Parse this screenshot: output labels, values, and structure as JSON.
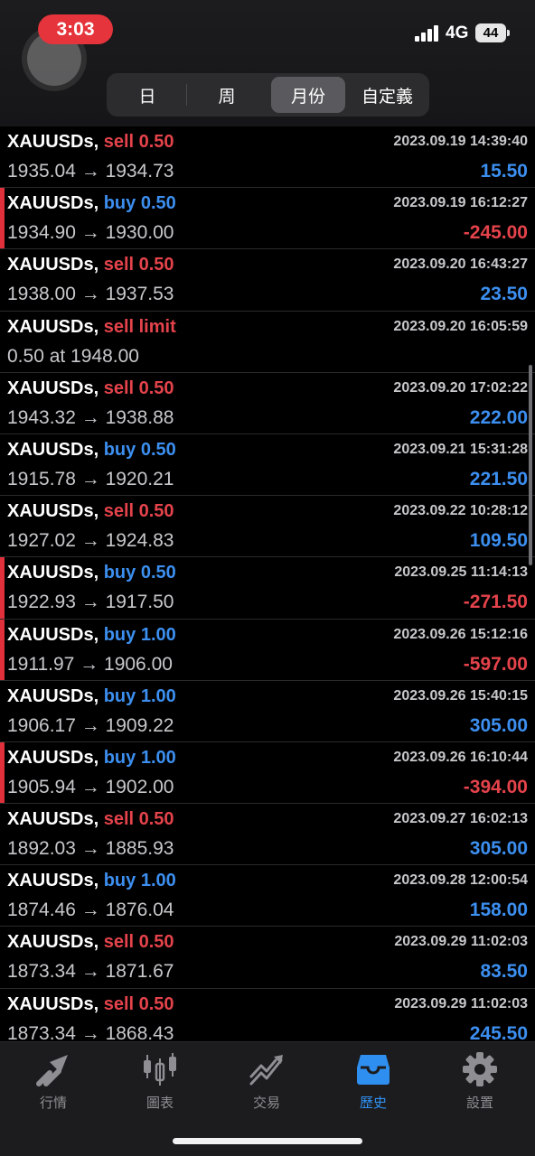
{
  "status_bar": {
    "time": "3:03",
    "network": "4G",
    "battery": "44"
  },
  "periods": [
    {
      "label": "日",
      "active": false
    },
    {
      "label": "周",
      "active": false
    },
    {
      "label": "月份",
      "active": true
    },
    {
      "label": "自定義",
      "active": false
    }
  ],
  "deals": [
    {
      "symbol": "XAUUSDs,",
      "side": "sell",
      "volume": "0.50",
      "datetime": "2023.09.19 14:39:40",
      "prices": "1935.04 → 1934.73",
      "profit": "15.50"
    },
    {
      "symbol": "XAUUSDs,",
      "side": "buy",
      "volume": "0.50",
      "datetime": "2023.09.19 16:12:27",
      "prices": "1934.90 → 1930.00",
      "profit": "-245.00"
    },
    {
      "symbol": "XAUUSDs,",
      "side": "sell",
      "volume": "0.50",
      "datetime": "2023.09.20 16:43:27",
      "prices": "1938.00 → 1937.53",
      "profit": "23.50"
    },
    {
      "symbol": "XAUUSDs,",
      "side": "sell",
      "volume": "limit",
      "datetime": "2023.09.20 16:05:59",
      "prices": "0.50 at 1948.00",
      "profit": ""
    },
    {
      "symbol": "XAUUSDs,",
      "side": "sell",
      "volume": "0.50",
      "datetime": "2023.09.20 17:02:22",
      "prices": "1943.32 → 1938.88",
      "profit": "222.00"
    },
    {
      "symbol": "XAUUSDs,",
      "side": "buy",
      "volume": "0.50",
      "datetime": "2023.09.21 15:31:28",
      "prices": "1915.78 → 1920.21",
      "profit": "221.50"
    },
    {
      "symbol": "XAUUSDs,",
      "side": "sell",
      "volume": "0.50",
      "datetime": "2023.09.22 10:28:12",
      "prices": "1927.02 → 1924.83",
      "profit": "109.50"
    },
    {
      "symbol": "XAUUSDs,",
      "side": "buy",
      "volume": "0.50",
      "datetime": "2023.09.25 11:14:13",
      "prices": "1922.93 → 1917.50",
      "profit": "-271.50"
    },
    {
      "symbol": "XAUUSDs,",
      "side": "buy",
      "volume": "1.00",
      "datetime": "2023.09.26 15:12:16",
      "prices": "1911.97 → 1906.00",
      "profit": "-597.00"
    },
    {
      "symbol": "XAUUSDs,",
      "side": "buy",
      "volume": "1.00",
      "datetime": "2023.09.26 15:40:15",
      "prices": "1906.17 → 1909.22",
      "profit": "305.00"
    },
    {
      "symbol": "XAUUSDs,",
      "side": "buy",
      "volume": "1.00",
      "datetime": "2023.09.26 16:10:44",
      "prices": "1905.94 → 1902.00",
      "profit": "-394.00"
    },
    {
      "symbol": "XAUUSDs,",
      "side": "sell",
      "volume": "0.50",
      "datetime": "2023.09.27 16:02:13",
      "prices": "1892.03 → 1885.93",
      "profit": "305.00"
    },
    {
      "symbol": "XAUUSDs,",
      "side": "buy",
      "volume": "1.00",
      "datetime": "2023.09.28 12:00:54",
      "prices": "1874.46 → 1876.04",
      "profit": "158.00"
    },
    {
      "symbol": "XAUUSDs,",
      "side": "sell",
      "volume": "0.50",
      "datetime": "2023.09.29 11:02:03",
      "prices": "1873.34 → 1871.67",
      "profit": "83.50"
    },
    {
      "symbol": "XAUUSDs,",
      "side": "sell",
      "volume": "0.50",
      "datetime": "2023.09.29 11:02:03",
      "prices": "1873.34 → 1868.43",
      "profit": "245.50"
    }
  ],
  "tabs": [
    {
      "label": "行情",
      "icon": "quotes-icon",
      "active": false
    },
    {
      "label": "圖表",
      "icon": "chart-icon",
      "active": false
    },
    {
      "label": "交易",
      "icon": "trade-icon",
      "active": false
    },
    {
      "label": "歷史",
      "icon": "history-icon",
      "active": true
    },
    {
      "label": "設置",
      "icon": "settings-icon",
      "active": false
    }
  ],
  "colors": {
    "sell": "#e5434b",
    "buy": "#3c8ff0",
    "loss_marker": "#e0303b",
    "tab_active": "#2f8ff0",
    "tab_inactive": "#8e8e93"
  }
}
